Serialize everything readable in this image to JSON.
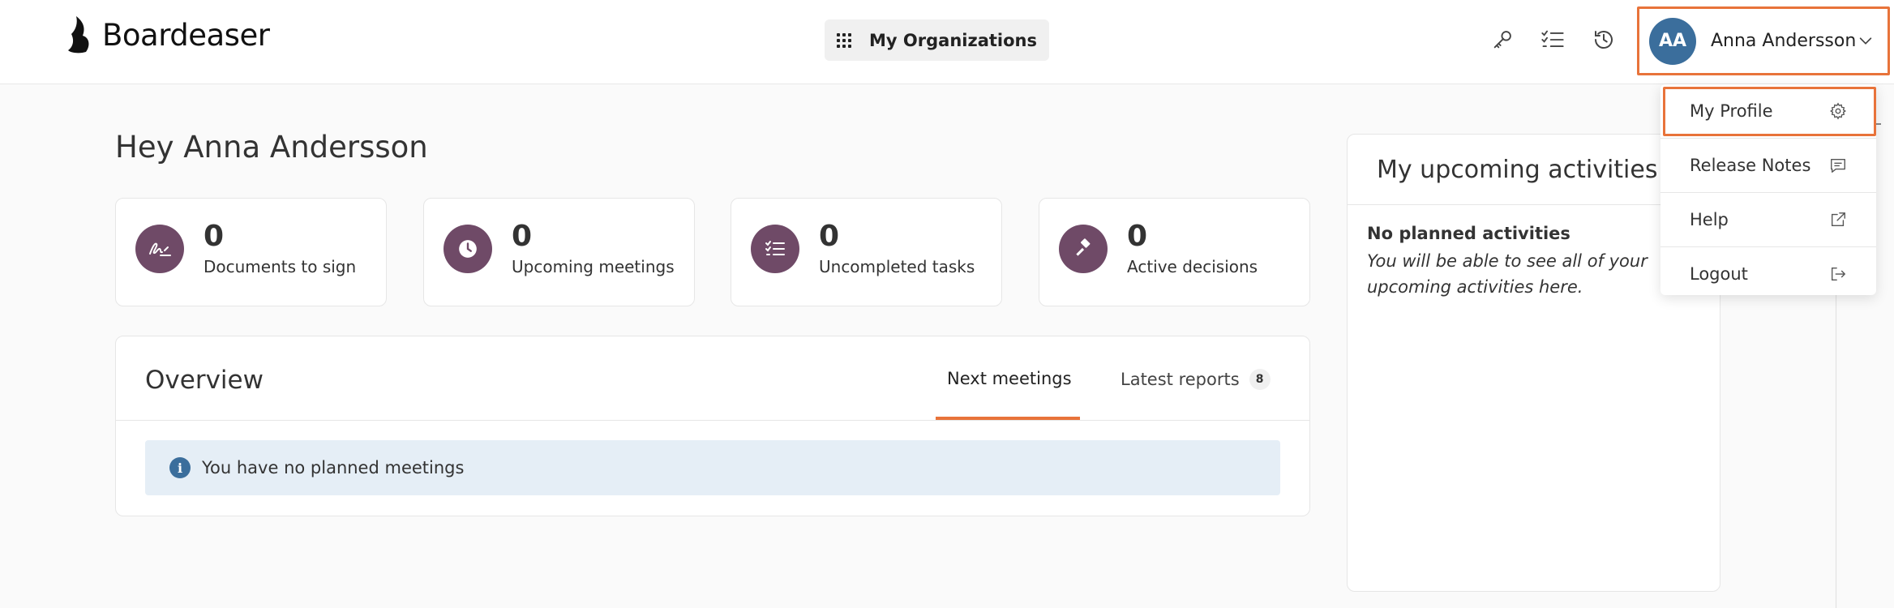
{
  "app": {
    "name": "Boardeaser"
  },
  "header": {
    "org_button": "My Organizations",
    "user": {
      "initials": "AA",
      "name": "Anna Andersson"
    }
  },
  "greeting": "Hey Anna Andersson",
  "stats": [
    {
      "value": "0",
      "label": "Documents to sign",
      "icon": "signature-icon"
    },
    {
      "value": "0",
      "label": "Upcoming meetings",
      "icon": "clock-icon"
    },
    {
      "value": "0",
      "label": "Uncompleted tasks",
      "icon": "checklist-icon"
    },
    {
      "value": "0",
      "label": "Active decisions",
      "icon": "gavel-icon"
    }
  ],
  "overview": {
    "title": "Overview",
    "tabs": [
      {
        "label": "Next meetings",
        "active": true
      },
      {
        "label": "Latest reports",
        "badge": "8"
      }
    ],
    "info": "You have no planned meetings"
  },
  "activities": {
    "title": "My upcoming activities",
    "empty_title": "No planned activities",
    "empty_text": "You will be able to see all of your upcoming activities here."
  },
  "menu": {
    "items": [
      {
        "label": "My Profile",
        "icon": "gear-icon"
      },
      {
        "label": "Release Notes",
        "icon": "chat-icon"
      },
      {
        "label": "Help",
        "icon": "external-link-icon"
      },
      {
        "label": "Logout",
        "icon": "logout-icon"
      }
    ]
  },
  "colors": {
    "accent": "#e8733a",
    "stat_icon_bg": "#6f4a67",
    "avatar_bg": "#3b6e9c",
    "info_bg": "#e5eef6"
  }
}
